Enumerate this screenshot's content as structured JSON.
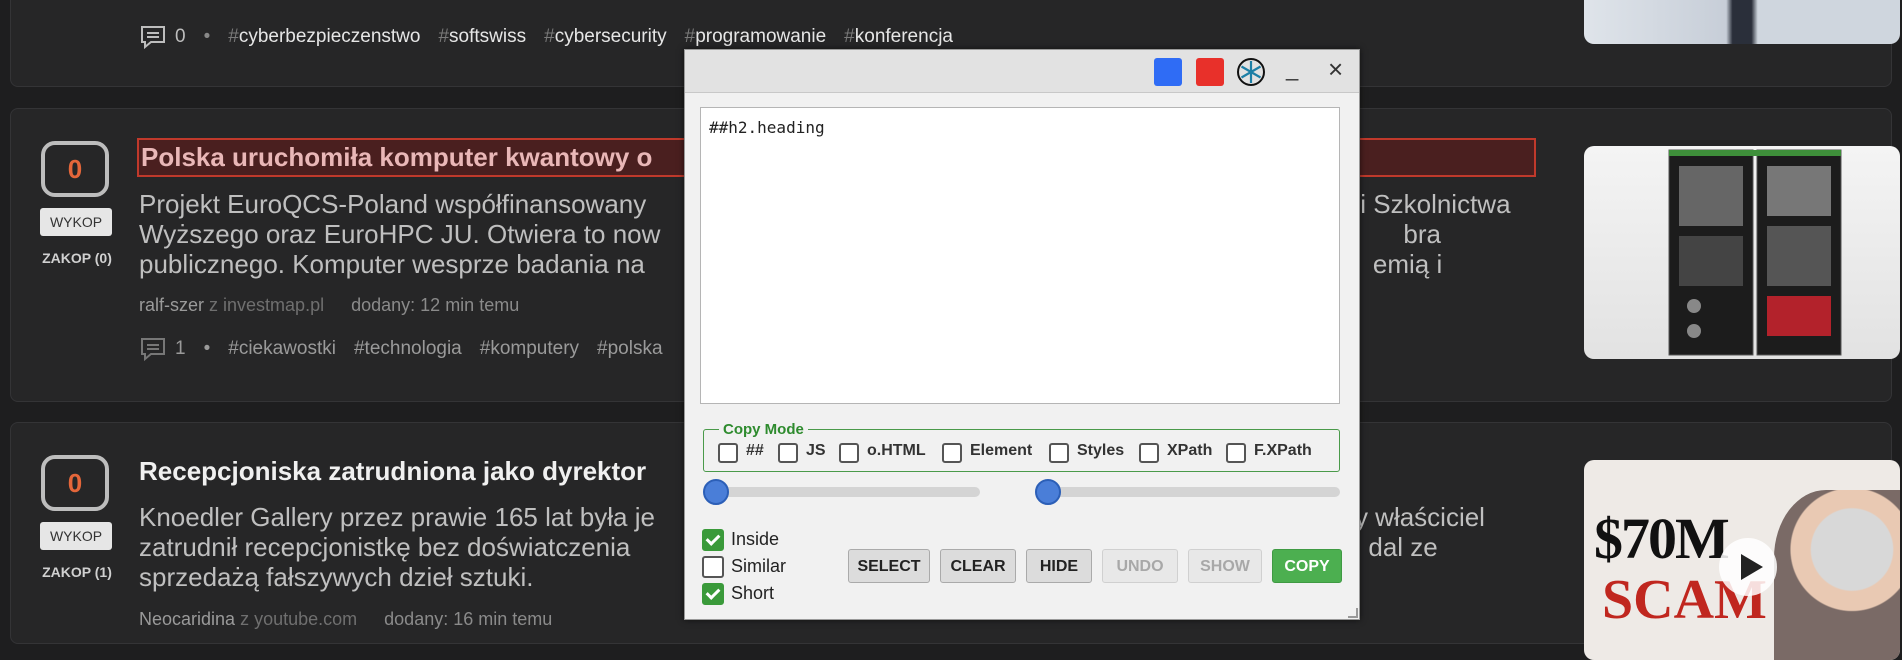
{
  "card1": {
    "comment_count": "0",
    "tags": [
      "cyberbezpieczenstwo",
      "softswiss",
      "cybersecurity",
      "programowanie",
      "konferencja"
    ]
  },
  "card2": {
    "votes": "0",
    "wykop_label": "WYKOP",
    "zakop_label": "ZAKOP (0)",
    "title": "Polska uruchomiła komputer kwantowy o",
    "desc_line1": "Projekt EuroQCS-Poland współfinansowany",
    "desc_line1_end": "i Szkolnictwa",
    "desc_line2": "Wyższego oraz EuroHPC JU. Otwiera to now",
    "desc_line2_end": "bra",
    "desc_line3": "publicznego. Komputer wesprze badania na",
    "desc_line3_end": "emią i",
    "author": "ralf-szer",
    "source": "z investmap.pl",
    "added": "dodany: 12 min temu",
    "comment_count": "1",
    "tags": [
      "ciekawostki",
      "technologia",
      "komputery",
      "polska"
    ]
  },
  "card3": {
    "votes": "0",
    "wykop_label": "WYKOP",
    "zakop_label": "ZAKOP (1)",
    "title": "Recepcjoniska zatrudniona jako dyrektor",
    "desc_line1": "Knoedler Gallery przez prawie 165 lat była je",
    "desc_line1_end": "y właściciel",
    "desc_line2": "zatrudnił recepcjonistkę bez doświatczenia",
    "desc_line2_end": "dal ze",
    "desc_line3": "sprzedażą fałszywych dzieł sztuki.",
    "author": "Neocaridina",
    "source": "z youtube.com",
    "added": "dodany: 16 min temu",
    "thumb_text1": "$70M",
    "thumb_text2": "SCAM"
  },
  "popup": {
    "minimize_label": "_",
    "close_label": "×",
    "code": "##h2.heading",
    "copy_mode_legend": "Copy Mode",
    "modes": [
      "##",
      "JS",
      "o.HTML",
      "Element",
      "Styles",
      "XPath",
      "F.XPath"
    ],
    "options": [
      {
        "label": "Inside",
        "checked": true
      },
      {
        "label": "Similar",
        "checked": false
      },
      {
        "label": "Short",
        "checked": true
      }
    ],
    "buttons": {
      "select": "SELECT",
      "clear": "CLEAR",
      "hide": "HIDE",
      "undo": "UNDO",
      "show": "SHOW",
      "copy": "COPY"
    },
    "colors": {
      "blue": "#2f6cf5",
      "red": "#e8302a",
      "copy_green": "#4caf50"
    }
  }
}
